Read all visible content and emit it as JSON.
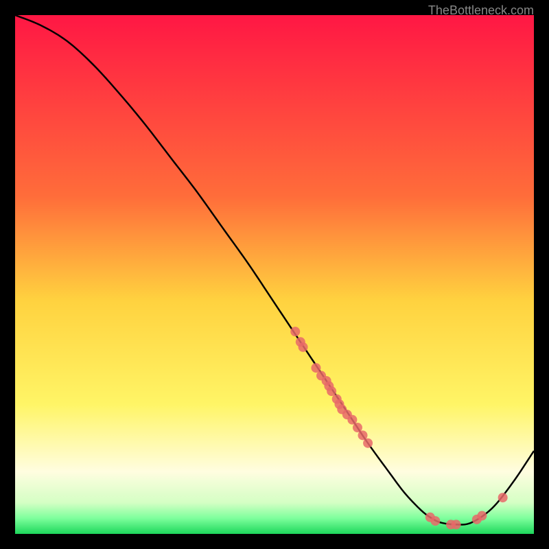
{
  "watermark": "TheBottleneck.com",
  "chart_data": {
    "type": "line",
    "title": "",
    "xlabel": "",
    "ylabel": "",
    "xlim": [
      0,
      100
    ],
    "ylim": [
      0,
      100
    ],
    "series": [
      {
        "name": "curve",
        "x": [
          0,
          5,
          10,
          15,
          20,
          25,
          30,
          35,
          40,
          45,
          50,
          55,
          60,
          65,
          68,
          72,
          75,
          78,
          80,
          82,
          85,
          88,
          92,
          96,
          100
        ],
        "y": [
          100,
          98,
          95,
          90.5,
          85,
          79,
          72.5,
          66,
          59,
          52,
          44.5,
          37,
          29.5,
          22,
          17.5,
          12,
          8,
          4.8,
          3.2,
          2.2,
          1.8,
          2.2,
          5,
          10,
          16
        ]
      }
    ],
    "points": [
      {
        "x": 54,
        "y": 39
      },
      {
        "x": 55,
        "y": 37
      },
      {
        "x": 55.5,
        "y": 36
      },
      {
        "x": 58,
        "y": 32
      },
      {
        "x": 59,
        "y": 30.5
      },
      {
        "x": 60,
        "y": 29.5
      },
      {
        "x": 60.5,
        "y": 28.5
      },
      {
        "x": 61,
        "y": 27.5
      },
      {
        "x": 62,
        "y": 26
      },
      {
        "x": 62.5,
        "y": 25
      },
      {
        "x": 63,
        "y": 24
      },
      {
        "x": 64,
        "y": 23
      },
      {
        "x": 65,
        "y": 22
      },
      {
        "x": 66,
        "y": 20.5
      },
      {
        "x": 67,
        "y": 19
      },
      {
        "x": 68,
        "y": 17.5
      },
      {
        "x": 80,
        "y": 3.2
      },
      {
        "x": 81,
        "y": 2.5
      },
      {
        "x": 84,
        "y": 1.8
      },
      {
        "x": 85,
        "y": 1.8
      },
      {
        "x": 89,
        "y": 2.8
      },
      {
        "x": 90,
        "y": 3.5
      },
      {
        "x": 94,
        "y": 7
      }
    ],
    "gradient_stops": [
      {
        "offset": 0,
        "color": "#ff1744"
      },
      {
        "offset": 0.35,
        "color": "#ff6d3a"
      },
      {
        "offset": 0.55,
        "color": "#ffd23f"
      },
      {
        "offset": 0.75,
        "color": "#fff566"
      },
      {
        "offset": 0.88,
        "color": "#fffde0"
      },
      {
        "offset": 0.94,
        "color": "#d4ffc4"
      },
      {
        "offset": 0.97,
        "color": "#7dff9c"
      },
      {
        "offset": 1.0,
        "color": "#1dd75b"
      }
    ],
    "point_color": "#e86868",
    "curve_color": "#000000"
  }
}
